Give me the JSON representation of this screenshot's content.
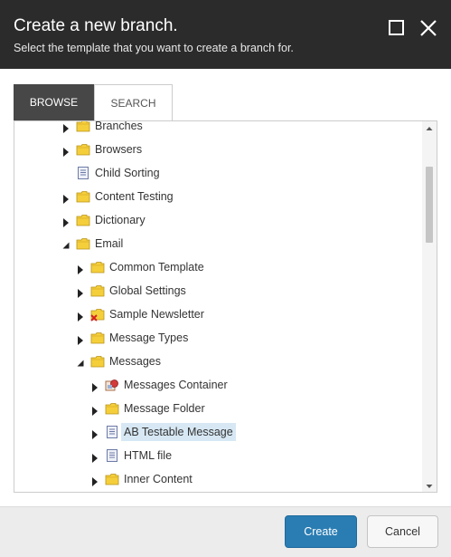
{
  "dialog": {
    "title": "Create a new branch.",
    "subtitle": "Select the template that you want to create a branch for.",
    "maximize_icon": "maximize-icon",
    "close_icon": "close-icon"
  },
  "tabs": [
    {
      "label": "BROWSE",
      "active": true
    },
    {
      "label": "SEARCH",
      "active": false
    }
  ],
  "tree": [
    {
      "label": "Branches",
      "depth": 0,
      "state": "collapsed",
      "icon": "folder",
      "selected": false
    },
    {
      "label": "Browsers",
      "depth": 0,
      "state": "collapsed",
      "icon": "folder",
      "selected": false
    },
    {
      "label": "Child Sorting",
      "depth": 0,
      "state": "leaf",
      "icon": "document",
      "selected": false
    },
    {
      "label": "Content Testing",
      "depth": 0,
      "state": "collapsed",
      "icon": "folder",
      "selected": false
    },
    {
      "label": "Dictionary",
      "depth": 0,
      "state": "collapsed",
      "icon": "folder",
      "selected": false
    },
    {
      "label": "Email",
      "depth": 0,
      "state": "expanded",
      "icon": "folder",
      "selected": false
    },
    {
      "label": "Common Template",
      "depth": 1,
      "state": "collapsed",
      "icon": "folder",
      "selected": false
    },
    {
      "label": "Global Settings",
      "depth": 1,
      "state": "collapsed",
      "icon": "folder",
      "selected": false
    },
    {
      "label": "Sample Newsletter",
      "depth": 1,
      "state": "collapsed",
      "icon": "folder-x",
      "selected": false
    },
    {
      "label": "Message Types",
      "depth": 1,
      "state": "collapsed",
      "icon": "folder",
      "selected": false
    },
    {
      "label": "Messages",
      "depth": 1,
      "state": "expanded",
      "icon": "folder",
      "selected": false
    },
    {
      "label": "Messages Container",
      "depth": 2,
      "state": "collapsed",
      "icon": "container",
      "selected": false
    },
    {
      "label": "Message Folder",
      "depth": 2,
      "state": "collapsed",
      "icon": "folder",
      "selected": false
    },
    {
      "label": "AB Testable Message",
      "depth": 2,
      "state": "collapsed",
      "icon": "document",
      "selected": true
    },
    {
      "label": "HTML file",
      "depth": 2,
      "state": "collapsed",
      "icon": "document",
      "selected": false
    },
    {
      "label": "Inner Content",
      "depth": 2,
      "state": "collapsed",
      "icon": "folder",
      "selected": false
    }
  ],
  "buttons": {
    "create": "Create",
    "cancel": "Cancel"
  },
  "colors": {
    "header_bg": "#2b2b2b",
    "active_tab_bg": "#474747",
    "primary_button": "#2a7db3",
    "selection": "#d7e8f4",
    "folder_yellow": "#f5cf3b"
  }
}
